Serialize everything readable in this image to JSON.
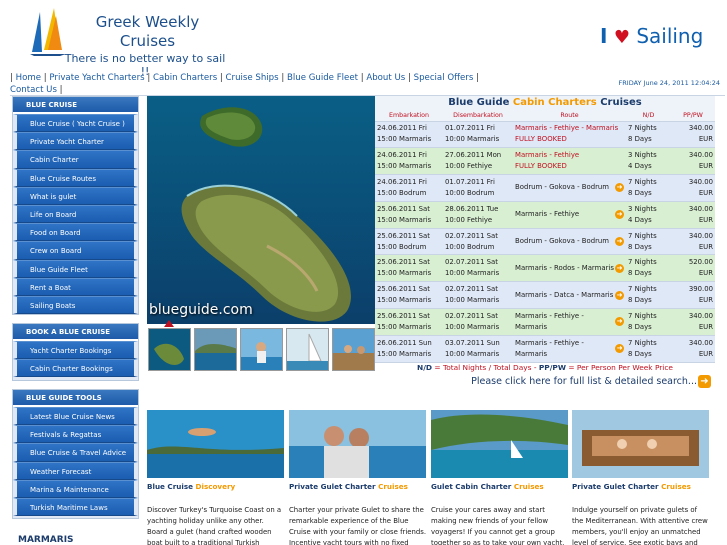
{
  "header": {
    "title_line1": "Greek Weekly",
    "title_line2": "Cruises",
    "slogan": "There is no better way to sail !!",
    "brand_i": "I",
    "brand_sailing": "Sailing"
  },
  "nav": {
    "items": [
      "Home",
      "Private Yacht Charters",
      "Cabin Charters",
      "Cruise Ships",
      "Blue Guide Fleet",
      "About Us",
      "Special Offers",
      "Contact Us"
    ],
    "date": "FRIDAY June 24, 2011 12:04:24"
  },
  "sidebar": {
    "section1": {
      "heading": "BLUE CRUISE",
      "items": [
        "Blue Cruise ( Yacht Cruise )",
        "Private Yacht Charter",
        "Cabin Charter",
        "Blue Cruise Routes",
        "What is gulet",
        "Life on Board",
        "Food on Board",
        "Crew on Board",
        "Blue Guide Fleet",
        "Rent a Boat",
        "Sailing Boats"
      ]
    },
    "section2": {
      "heading": "BOOK A BLUE CRUISE",
      "items": [
        "Yacht Charter Bookings",
        "Cabin Charter Bookings"
      ]
    },
    "section3": {
      "heading": "BLUE GUIDE TOOLS",
      "items": [
        "Latest Blue Cruise News",
        "Festivals & Regattas",
        "Blue Cruise & Travel Advice",
        "Weather Forecast",
        "Marina & Maintenance",
        "Turkish Maritime Laws"
      ]
    },
    "marmaris_logo": "MARMARIS"
  },
  "photo": {
    "caption": "blueguide.com"
  },
  "cruise_table": {
    "title_pre": "Blue Guide",
    "title_accent": "Cabin Charters",
    "title_post": "Cruises",
    "headers": [
      "Embarkation",
      "Disembarkation",
      "Route",
      "N/D",
      "PP/PW"
    ],
    "rows": [
      {
        "emb1": "24.06.2011 Fri",
        "emb2": "15:00 Marmaris",
        "dis1": "01.07.2011 Fri",
        "dis2": "10:00 Marmaris",
        "route1": "Marmaris - Fethiye - Marmaris",
        "route2": "FULLY BOOKED",
        "nd1": "7 Nights",
        "nd2": "8 Days",
        "price1": "340.00",
        "price2": "EUR",
        "style": "blue",
        "booked": true
      },
      {
        "emb1": "24.06.2011 Fri",
        "emb2": "15:00 Marmaris",
        "dis1": "27.06.2011 Mon",
        "dis2": "10:00 Fethiye",
        "route1": "Marmaris - Fethiye",
        "route2": "FULLY BOOKED",
        "nd1": "3 Nights",
        "nd2": "4 Days",
        "price1": "340.00",
        "price2": "EUR",
        "style": "green",
        "booked": true
      },
      {
        "emb1": "24.06.2011 Fri",
        "emb2": "15:00 Bodrum",
        "dis1": "01.07.2011 Fri",
        "dis2": "10:00 Bodrum",
        "route1": "Bodrum - Gokova - Bodrum",
        "route2": "",
        "nd1": "7 Nights",
        "nd2": "8 Days",
        "price1": "340.00",
        "price2": "EUR",
        "style": "blue",
        "booked": false
      },
      {
        "emb1": "25.06.2011 Sat",
        "emb2": "15:00 Marmaris",
        "dis1": "28.06.2011 Tue",
        "dis2": "10:00 Fethiye",
        "route1": "Marmaris - Fethiye",
        "route2": "",
        "nd1": "3 Nights",
        "nd2": "4 Days",
        "price1": "340.00",
        "price2": "EUR",
        "style": "green",
        "booked": false
      },
      {
        "emb1": "25.06.2011 Sat",
        "emb2": "15:00 Bodrum",
        "dis1": "02.07.2011 Sat",
        "dis2": "10:00 Bodrum",
        "route1": "Bodrum - Gokova - Bodrum",
        "route2": "",
        "nd1": "7 Nights",
        "nd2": "8 Days",
        "price1": "340.00",
        "price2": "EUR",
        "style": "blue",
        "booked": false
      },
      {
        "emb1": "25.06.2011 Sat",
        "emb2": "15:00 Marmaris",
        "dis1": "02.07.2011 Sat",
        "dis2": "10:00 Marmaris",
        "route1": "Marmaris - Rodos - Marmaris",
        "route2": "",
        "nd1": "7 Nights",
        "nd2": "8 Days",
        "price1": "520.00",
        "price2": "EUR",
        "style": "green",
        "booked": false
      },
      {
        "emb1": "25.06.2011 Sat",
        "emb2": "15:00 Marmaris",
        "dis1": "02.07.2011 Sat",
        "dis2": "10:00 Marmaris",
        "route1": "Marmaris - Datca - Marmaris",
        "route2": "",
        "nd1": "7 Nights",
        "nd2": "8 Days",
        "price1": "390.00",
        "price2": "EUR",
        "style": "blue",
        "booked": false
      },
      {
        "emb1": "25.06.2011 Sat",
        "emb2": "15:00 Marmaris",
        "dis1": "02.07.2011 Sat",
        "dis2": "10:00 Marmaris",
        "route1": "Marmaris - Fethiye - Marmaris",
        "route2": "",
        "nd1": "7 Nights",
        "nd2": "8 Days",
        "price1": "340.00",
        "price2": "EUR",
        "style": "green",
        "booked": false
      },
      {
        "emb1": "26.06.2011 Sun",
        "emb2": "15:00 Marmaris",
        "dis1": "03.07.2011 Sun",
        "dis2": "10:00 Marmaris",
        "route1": "Marmaris - Fethiye - Marmaris",
        "route2": "",
        "nd1": "7 Nights",
        "nd2": "8 Days",
        "price1": "340.00",
        "price2": "EUR",
        "style": "blue",
        "booked": false
      }
    ],
    "legend_nd": "N/D",
    "legend_nd_text": "= Total Nights / Total Days -",
    "legend_pp": "PP/PW",
    "legend_pp_text": "= Per Person Per Week Price",
    "full_list": "Please click here for full list & detailed search..."
  },
  "cards": [
    {
      "title": "Blue Cruise",
      "accent": "Discovery",
      "text": "Discover Turkey's Turquoise Coast on a yachting holiday unlike any other. Board a gulet (hand crafted wooden boat built to a traditional Turkish design)"
    },
    {
      "title": "Private Gulet Charter",
      "accent": "Cruises",
      "text": "Charter your private Gulet to share the remarkable experience of the Blue Cruise with your family or close friends. Incentive yacht tours with no fixed"
    },
    {
      "title": "Gulet Cabin Charter",
      "accent": "Cruises",
      "text": "Cruise your cares away and start making new friends of your fellow voyagers! If you cannot get a group together so as to take your own yacht,"
    },
    {
      "title": "Private Gulet Charter",
      "accent": "Cruises",
      "text": "Indulge yourself on private gulets of the Mediterranean. With attentive crew members, you'll enjoy an unmatched level of service. See exotic bays and"
    }
  ]
}
